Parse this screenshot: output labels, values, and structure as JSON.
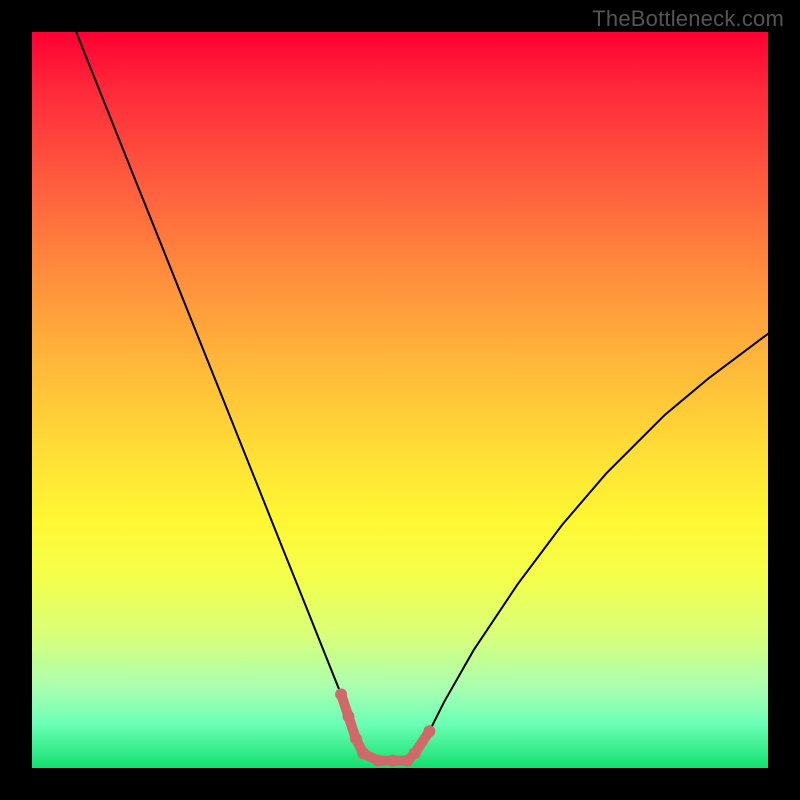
{
  "watermark": "TheBottleneck.com",
  "chart_data": {
    "type": "line",
    "title": "",
    "xlabel": "",
    "ylabel": "",
    "xlim": [
      0,
      100
    ],
    "ylim": [
      0,
      100
    ],
    "grid": false,
    "legend": false,
    "series": [
      {
        "name": "curve",
        "color": "#000000",
        "stroke_width": 2,
        "x": [
          6,
          10,
          14,
          18,
          22,
          26,
          30,
          34,
          36,
          38,
          40,
          42,
          43,
          44,
          45,
          47,
          49,
          51,
          52,
          54,
          56,
          60,
          66,
          72,
          78,
          86,
          92,
          100
        ],
        "y": [
          100,
          90,
          80,
          70,
          60,
          50,
          40,
          30,
          25,
          20,
          15,
          10,
          7,
          4,
          2,
          1,
          1,
          1,
          2,
          5,
          9,
          16,
          25,
          33,
          40,
          48,
          53,
          59
        ]
      },
      {
        "name": "highlight",
        "color": "#d06a6a",
        "stroke_width": 10,
        "marker": "circle",
        "x": [
          42,
          43,
          44,
          45,
          47,
          49,
          51,
          52,
          54
        ],
        "y": [
          10,
          7,
          4,
          2,
          1,
          1,
          1,
          2,
          5
        ]
      }
    ],
    "background_gradient": {
      "direction": "top-to-bottom",
      "stops": [
        {
          "pos": 0.0,
          "color": "#ff0033"
        },
        {
          "pos": 0.5,
          "color": "#ffcc33"
        },
        {
          "pos": 0.75,
          "color": "#f4ff4a"
        },
        {
          "pos": 1.0,
          "color": "#12e06e"
        }
      ]
    }
  }
}
